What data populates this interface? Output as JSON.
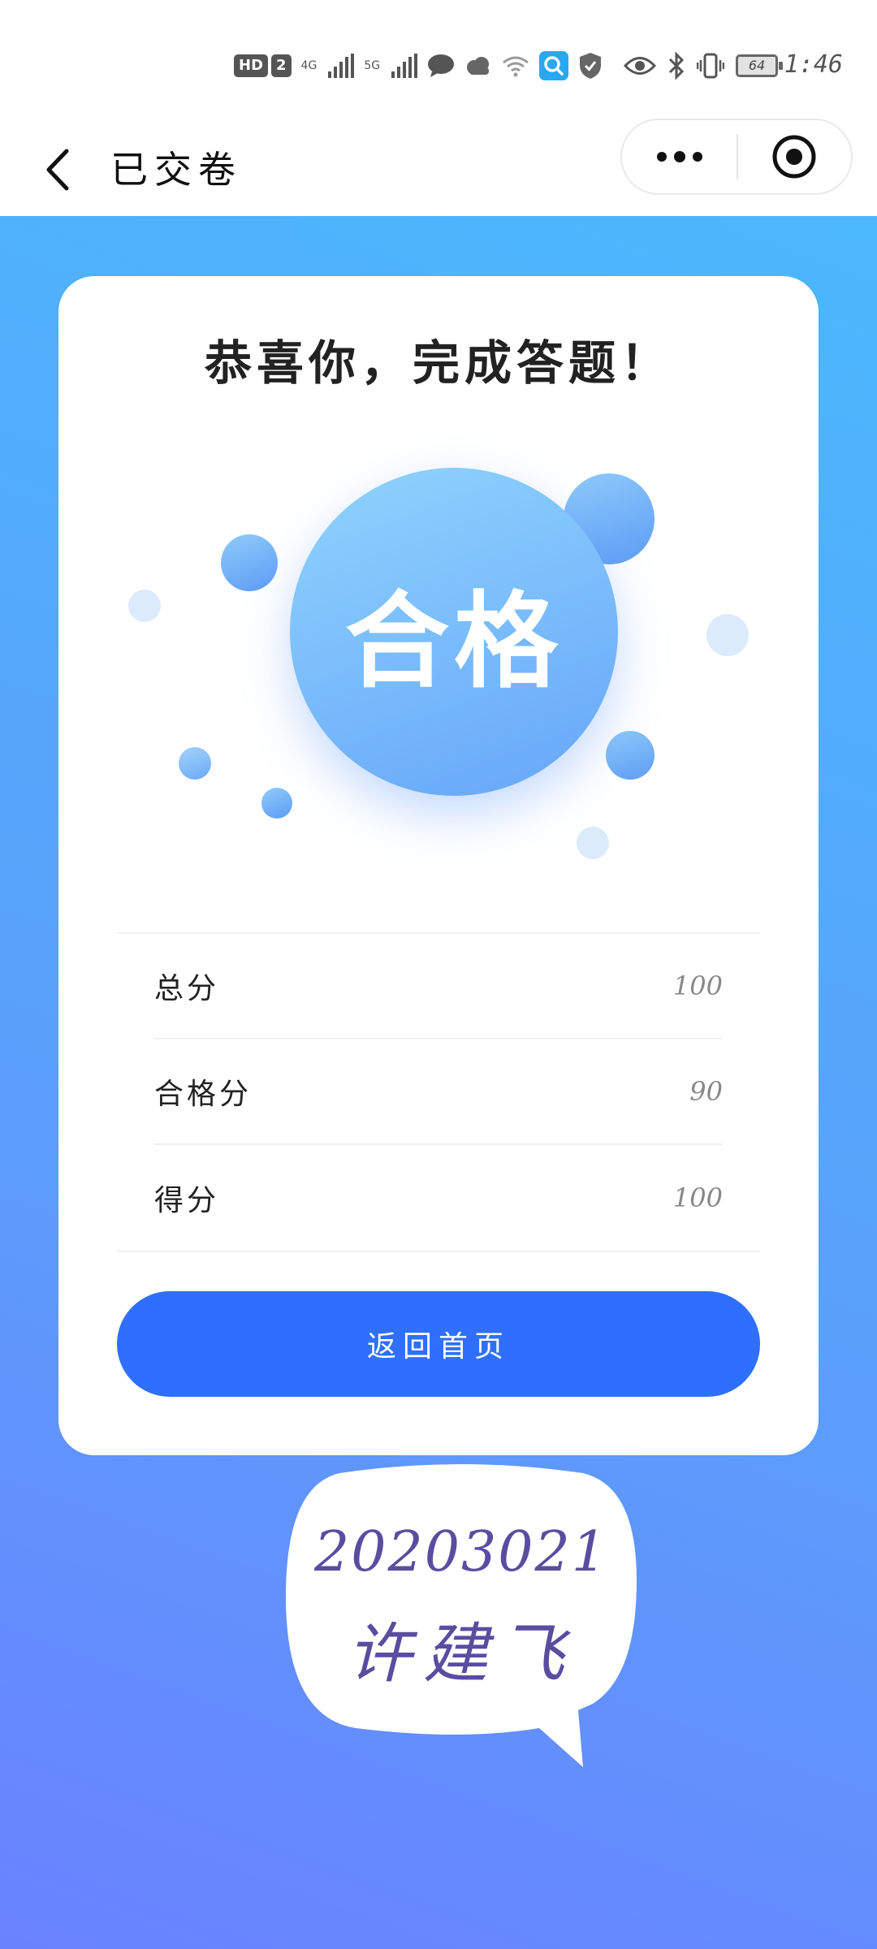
{
  "status_bar": {
    "hd_badge": "HD",
    "sim_badge": "2",
    "net1": "4G",
    "net2": "5G",
    "battery": "64",
    "time": "1:46"
  },
  "nav": {
    "title": "已交卷"
  },
  "card": {
    "headline": "恭喜你，完成答题！",
    "result": "合格",
    "rows": [
      {
        "label": "总分",
        "value": "100"
      },
      {
        "label": "合格分",
        "value": "90"
      },
      {
        "label": "得分",
        "value": "100"
      }
    ],
    "button": "返回首页"
  },
  "overlay": {
    "id_number": "20203021",
    "name": "许建飞"
  },
  "colors": {
    "primary_button": "#2f6ffd",
    "background_top": "#4bb8fd",
    "background_bottom": "#6a82ff",
    "overlay_text": "#5a4da0"
  }
}
